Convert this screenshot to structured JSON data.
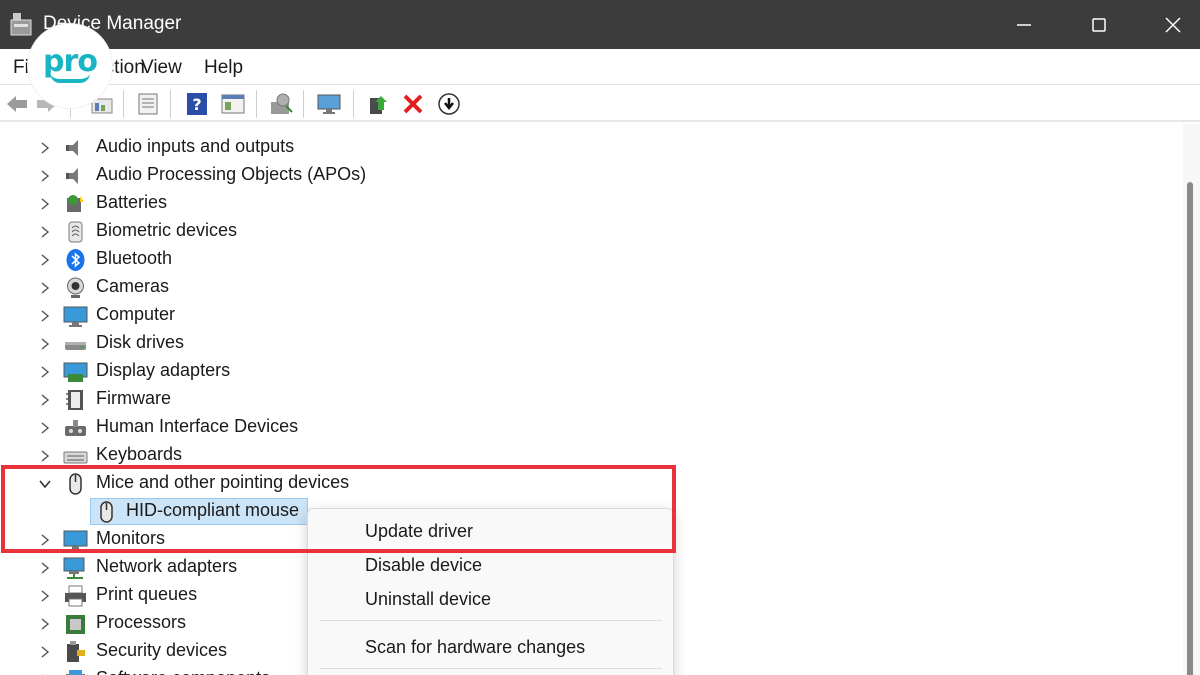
{
  "window": {
    "title": "Device Manager"
  },
  "menu": {
    "file": "File",
    "action": "Action",
    "view": "View",
    "help": "Help"
  },
  "logo": {
    "text": "pro"
  },
  "toolbar": {
    "icons": [
      "back-icon",
      "forward-icon",
      "show-hidden-icon",
      "properties-icon",
      "help-icon",
      "view-icon",
      "scan-hardware-icon",
      "monitor-icon",
      "update-driver-icon",
      "uninstall-icon",
      "download-icon"
    ]
  },
  "tree": {
    "categories": [
      {
        "label": "Audio inputs and outputs",
        "icon": "speaker-icon"
      },
      {
        "label": "Audio Processing Objects (APOs)",
        "icon": "speaker-icon"
      },
      {
        "label": "Batteries",
        "icon": "battery-icon"
      },
      {
        "label": "Biometric devices",
        "icon": "fingerprint-icon"
      },
      {
        "label": "Bluetooth",
        "icon": "bluetooth-icon"
      },
      {
        "label": "Cameras",
        "icon": "camera-icon"
      },
      {
        "label": "Computer",
        "icon": "computer-icon"
      },
      {
        "label": "Disk drives",
        "icon": "disk-icon"
      },
      {
        "label": "Display adapters",
        "icon": "display-adapter-icon"
      },
      {
        "label": "Firmware",
        "icon": "firmware-icon"
      },
      {
        "label": "Human Interface Devices",
        "icon": "hid-icon"
      },
      {
        "label": "Keyboards",
        "icon": "keyboard-icon"
      },
      {
        "label": "Mice and other pointing devices",
        "icon": "mouse-icon",
        "expanded": true
      },
      {
        "label": "HID-compliant mouse",
        "icon": "mouse-icon",
        "child": true,
        "selected": true
      },
      {
        "label": "Monitors",
        "icon": "monitor-icon"
      },
      {
        "label": "Network adapters",
        "icon": "network-icon"
      },
      {
        "label": "Print queues",
        "icon": "printer-icon"
      },
      {
        "label": "Processors",
        "icon": "processor-icon"
      },
      {
        "label": "Security devices",
        "icon": "security-icon"
      },
      {
        "label": "Software components",
        "icon": "software-icon"
      }
    ]
  },
  "context_menu": {
    "update_driver": "Update driver",
    "disable_device": "Disable device",
    "uninstall_device": "Uninstall device",
    "scan_hardware": "Scan for hardware changes"
  },
  "colors": {
    "titlebar": "#3c3c3c",
    "highlight": "#e8333a",
    "selection": "#cce4f7",
    "logo": "#19b5c4"
  }
}
